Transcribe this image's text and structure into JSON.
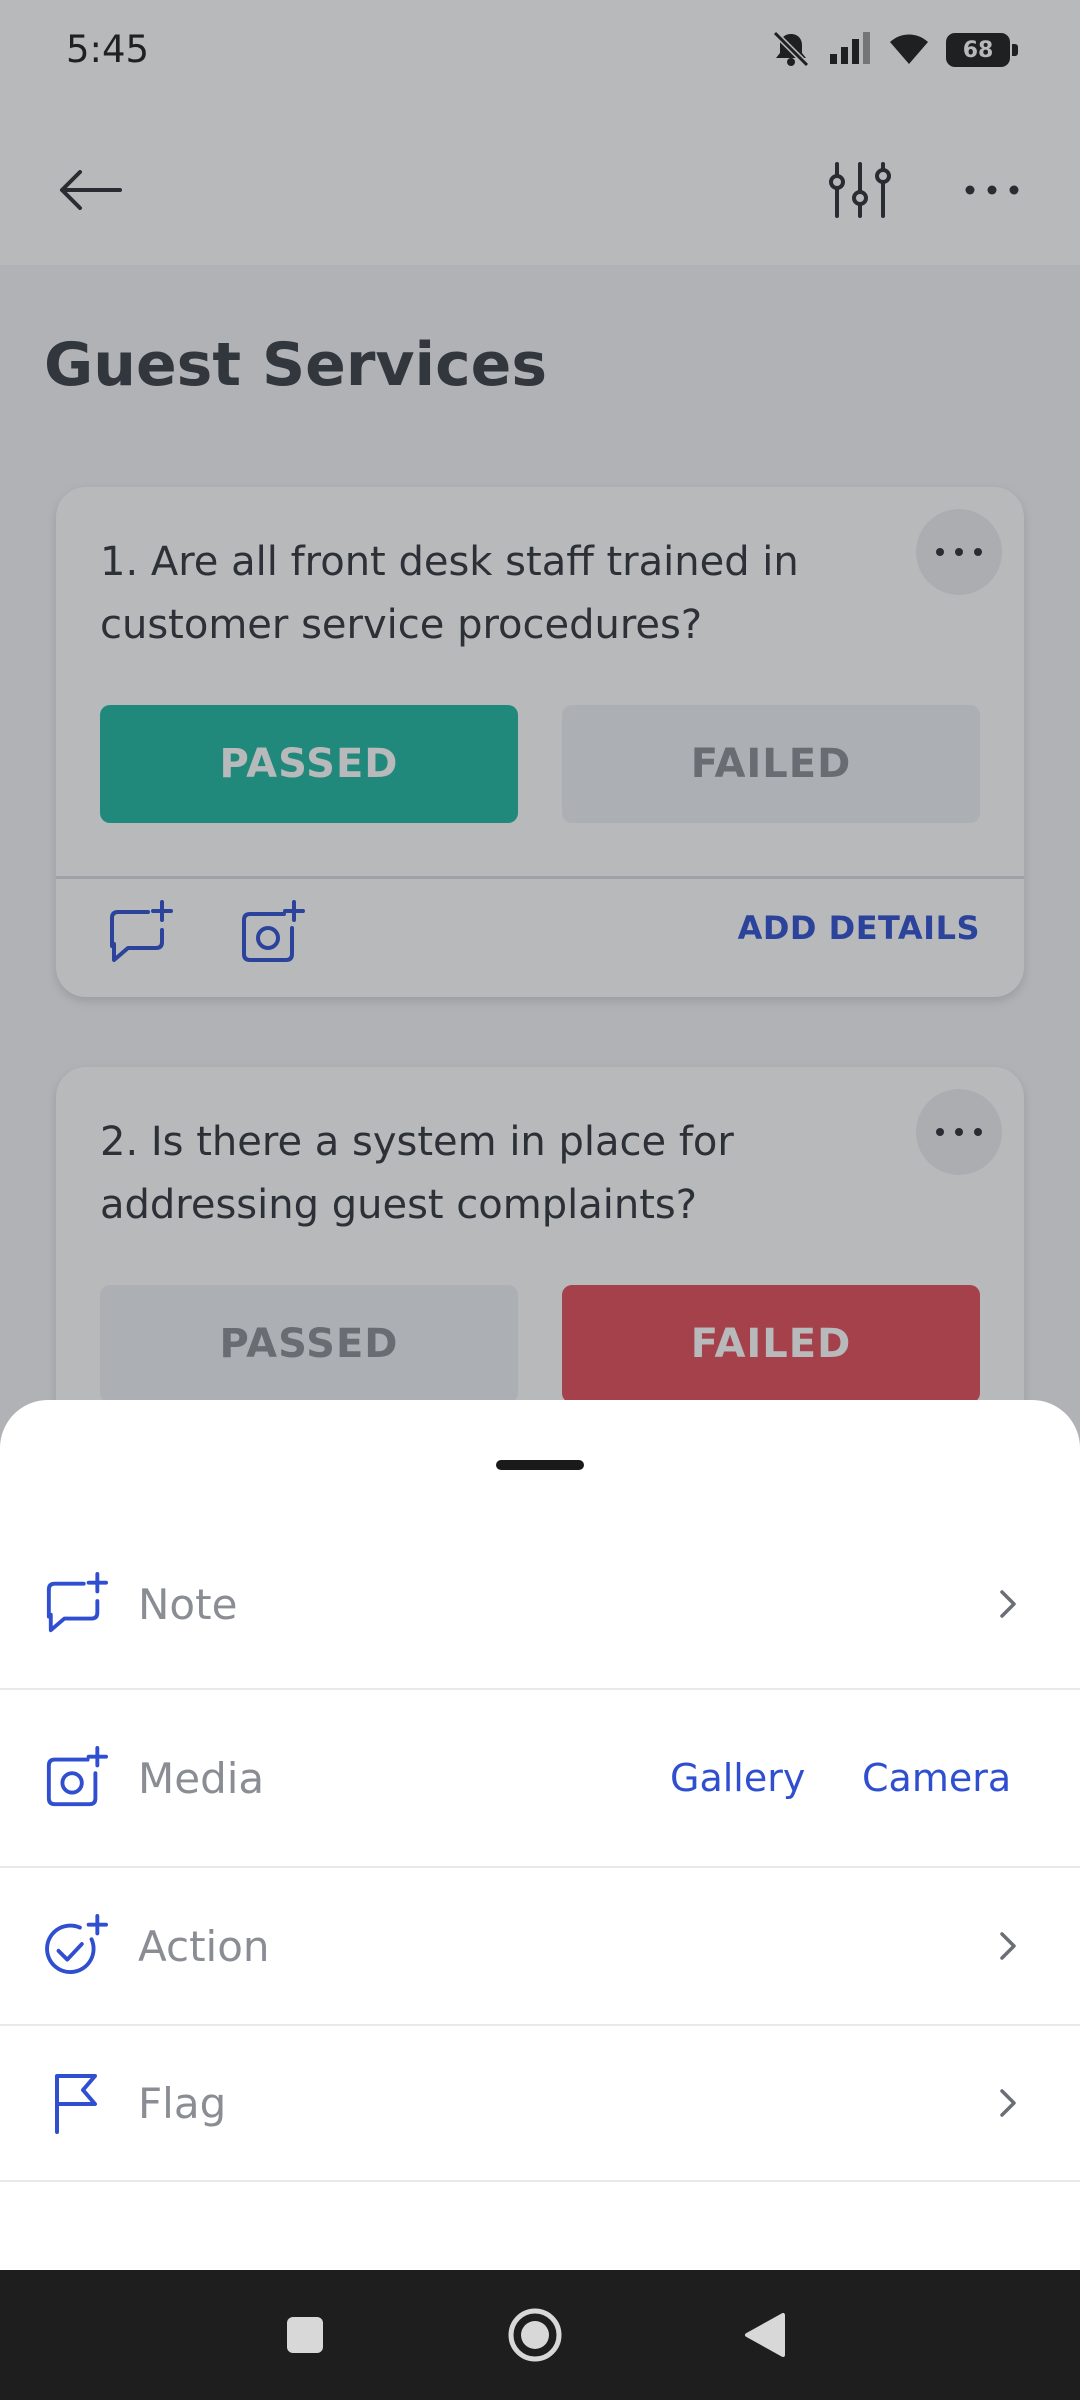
{
  "status_bar": {
    "time": "5:45",
    "battery": "68"
  },
  "header": {
    "title": "Guest Services"
  },
  "questions": [
    {
      "number_text": "1. Are all front desk staff trained in customer service procedures?",
      "passed_label": "PASSED",
      "failed_label": "FAILED",
      "selected": "passed",
      "add_details_label": "ADD DETAILS"
    },
    {
      "number_text": "2. Is there a system in place for addressing guest complaints?",
      "passed_label": "PASSED",
      "failed_label": "FAILED",
      "selected": "failed"
    }
  ],
  "sheet": {
    "items": [
      {
        "label": "Note",
        "icon": "note-add-icon"
      },
      {
        "label": "Media",
        "icon": "camera-add-icon",
        "links": [
          "Gallery",
          "Camera"
        ]
      },
      {
        "label": "Action",
        "icon": "action-add-icon"
      },
      {
        "label": "Flag",
        "icon": "flag-icon"
      }
    ]
  },
  "colors": {
    "accent": "#2f4fd0",
    "passed": "#1fb8a0",
    "failed": "#e24d58"
  }
}
